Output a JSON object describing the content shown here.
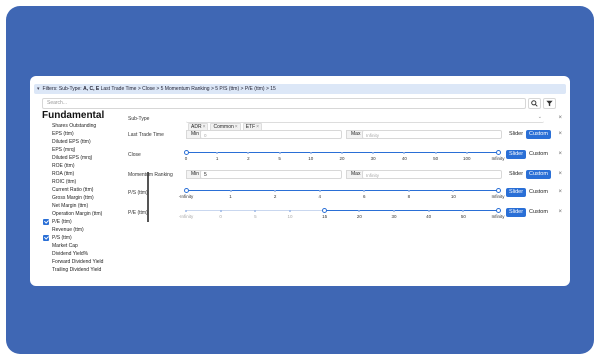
{
  "filters_bar": {
    "prefix": "Filters: Sub-Type: ",
    "subtype_value": "A, C, E",
    "rest": " Last Trade Time > Close > 5 Momentum Ranking > 5 P/S (ttm) > P/E (ttm) > 15"
  },
  "search": {
    "placeholder": "Search..."
  },
  "sidebar": {
    "heading": "Fundamental",
    "items": [
      {
        "label": "Shares Outstanding",
        "checked": false
      },
      {
        "label": "EPS (ttm)",
        "checked": false
      },
      {
        "label": "Diluted EPS (ttm)",
        "checked": false
      },
      {
        "label": "EPS (mrq)",
        "checked": false
      },
      {
        "label": "Diluted EPS (mrq)",
        "checked": false
      },
      {
        "label": "ROE (ttm)",
        "checked": false
      },
      {
        "label": "ROA (ttm)",
        "checked": false
      },
      {
        "label": "ROIC (ttm)",
        "checked": false
      },
      {
        "label": "Current Ratio (ttm)",
        "checked": false
      },
      {
        "label": "Gross Margin (ttm)",
        "checked": false
      },
      {
        "label": "Net Margin (ttm)",
        "checked": false
      },
      {
        "label": "Operation Margin (ttm)",
        "checked": false
      },
      {
        "label": "P/E (ttm)",
        "checked": true
      },
      {
        "label": "Revenue (ttm)",
        "checked": false
      },
      {
        "label": "P/S (ttm)",
        "checked": true
      },
      {
        "label": "Market Cap",
        "checked": false
      },
      {
        "label": "Dividend Yield%",
        "checked": false
      },
      {
        "label": "Forward Dividend Yield",
        "checked": false
      },
      {
        "label": "Trailing Dividend Yield",
        "checked": false
      }
    ]
  },
  "filters": {
    "subtype": {
      "label": "Sub-Type",
      "tags": [
        "ADR",
        "Common",
        "ETF"
      ]
    },
    "last_trade_time": {
      "label": "Last Trade Time",
      "min_label": "Min",
      "min_placeholder": "0",
      "max_label": "Max",
      "max_placeholder": "Infinity",
      "slider_label": "Slider",
      "custom_label": "Custom"
    },
    "close": {
      "label": "Close",
      "ticks": [
        "0",
        "1",
        "2",
        "5",
        "10",
        "20",
        "30",
        "40",
        "50",
        "100",
        "Infinity"
      ],
      "slider_label": "Slider",
      "custom_label": "Custom",
      "range_low_index": 0,
      "range_high_index": 10
    },
    "momentum": {
      "label": "Momentum Ranking",
      "min_label": "Min",
      "min_value": "5",
      "max_label": "Max",
      "max_placeholder": "Infinity",
      "slider_label": "Slider",
      "custom_label": "Custom"
    },
    "ps": {
      "label": "P/S (ttm)",
      "ticks": [
        "-Infinity",
        "1",
        "2",
        "4",
        "6",
        "8",
        "10",
        "Infinity"
      ],
      "slider_label": "Slider",
      "custom_label": "Custom",
      "range_low_index": 0,
      "range_high_index": 7
    },
    "pe": {
      "label": "P/E (ttm)",
      "ticks": [
        "-Infinity",
        "0",
        "5",
        "10",
        "15",
        "20",
        "30",
        "40",
        "50",
        "Infinity"
      ],
      "slider_label": "Slider",
      "custom_label": "Custom",
      "range_low_index": 4,
      "range_high_index": 9
    }
  },
  "remove_label": "×",
  "colors": {
    "frame": "#3f67b4",
    "accent": "#2a6fd6",
    "filters_bar": "#dce7f7"
  }
}
